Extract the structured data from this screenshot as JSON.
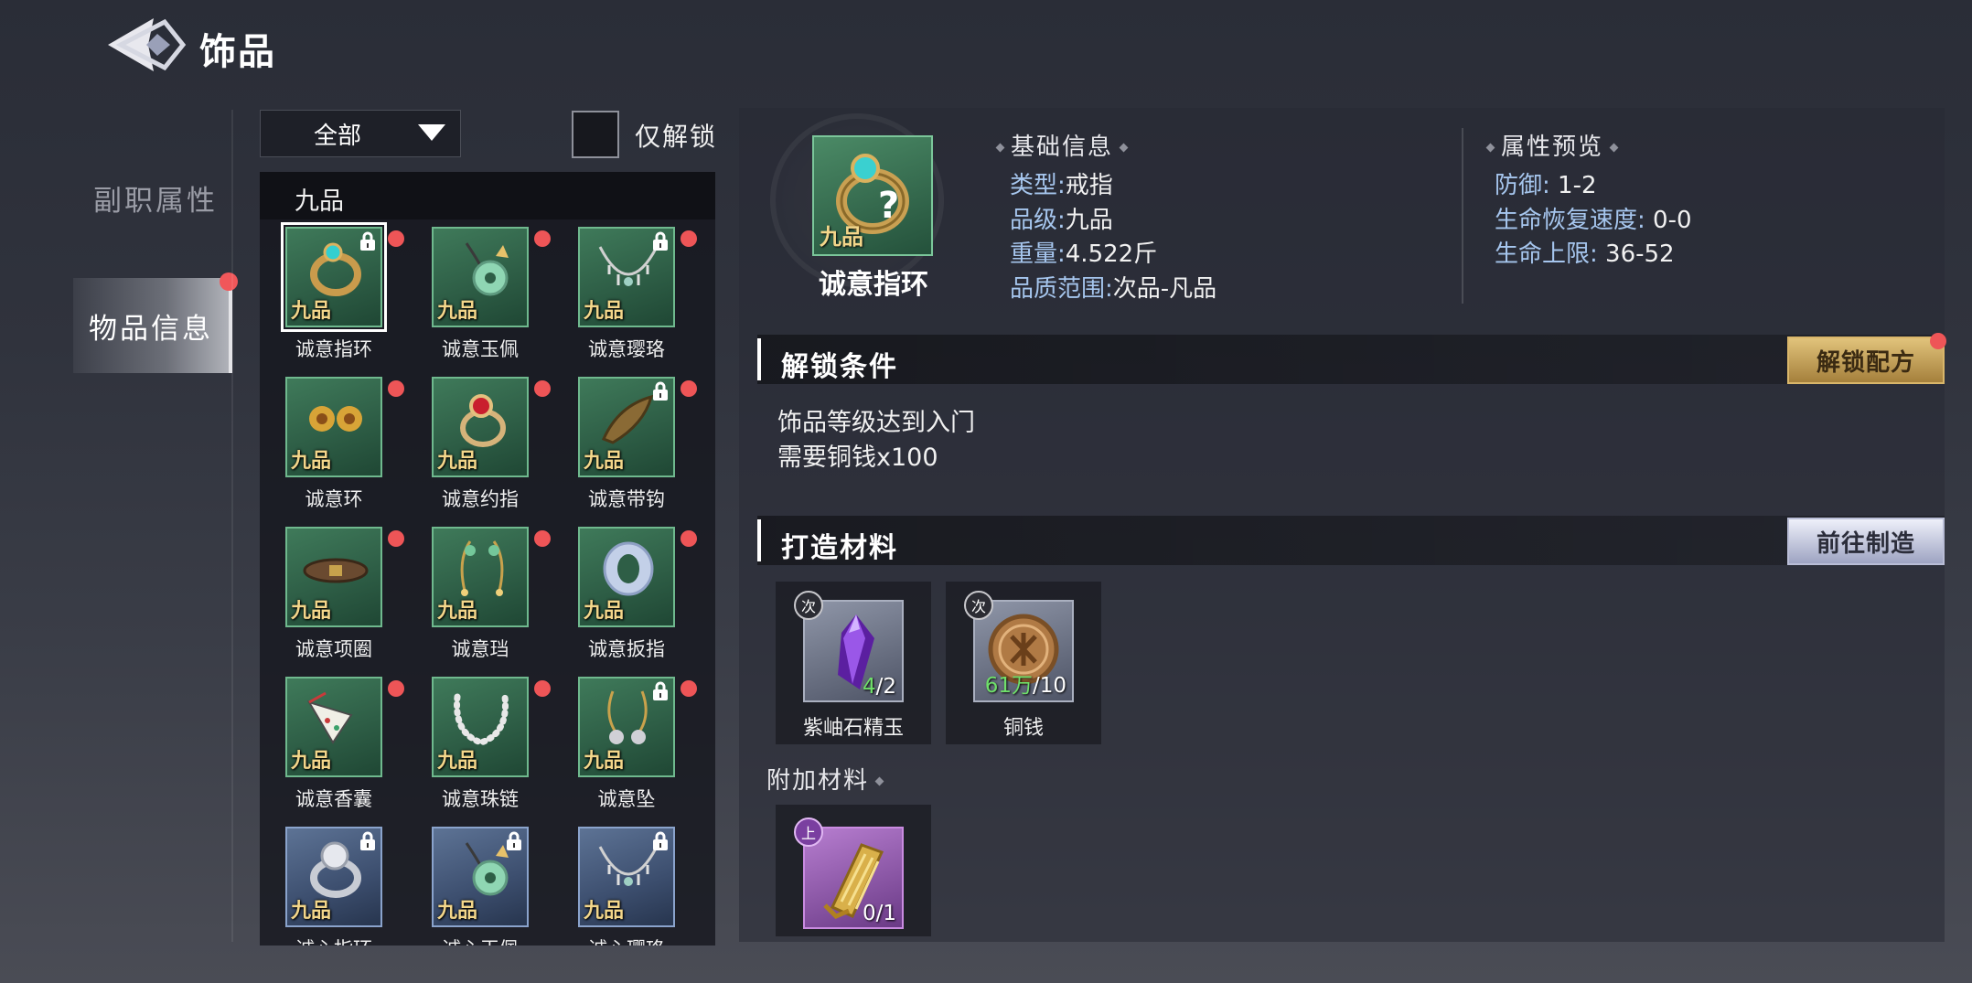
{
  "header": {
    "title": "饰品"
  },
  "sidebar": {
    "tabs": [
      {
        "label": "副职属性",
        "active": false
      },
      {
        "label": "物品信息",
        "active": true
      }
    ]
  },
  "filter": {
    "category_selected": "全部",
    "unlock_only_label": "仅解锁",
    "unlock_only_checked": false
  },
  "list": {
    "group_label": "九品",
    "items": [
      {
        "name": "诚意指环",
        "grade": "九品",
        "rarity": "green",
        "icon": "ring-icon",
        "locked": true,
        "alert": true,
        "selected": true
      },
      {
        "name": "诚意玉佩",
        "grade": "九品",
        "rarity": "green",
        "icon": "jade-pendant-icon",
        "locked": false,
        "alert": true
      },
      {
        "name": "诚意璎珞",
        "grade": "九品",
        "rarity": "green",
        "icon": "necklace-icon",
        "locked": true,
        "alert": true
      },
      {
        "name": "诚意环",
        "grade": "九品",
        "rarity": "green",
        "icon": "earrings-icon",
        "locked": false,
        "alert": true
      },
      {
        "name": "诚意约指",
        "grade": "九品",
        "rarity": "green",
        "icon": "ruby-ring-icon",
        "locked": false,
        "alert": true
      },
      {
        "name": "诚意带钩",
        "grade": "九品",
        "rarity": "green",
        "icon": "belt-hook-icon",
        "locked": true,
        "alert": true
      },
      {
        "name": "诚意项圈",
        "grade": "九品",
        "rarity": "green",
        "icon": "collar-icon",
        "locked": false,
        "alert": true
      },
      {
        "name": "诚意珰",
        "grade": "九品",
        "rarity": "green",
        "icon": "ear-pendant-icon",
        "locked": false,
        "alert": true
      },
      {
        "name": "诚意扳指",
        "grade": "九品",
        "rarity": "green",
        "icon": "thumb-ring-icon",
        "locked": false,
        "alert": true
      },
      {
        "name": "诚意香囊",
        "grade": "九品",
        "rarity": "green",
        "icon": "sachet-icon",
        "locked": false,
        "alert": true
      },
      {
        "name": "诚意珠链",
        "grade": "九品",
        "rarity": "green",
        "icon": "pearl-chain-icon",
        "locked": false,
        "alert": true
      },
      {
        "name": "诚意坠",
        "grade": "九品",
        "rarity": "green",
        "icon": "drop-pendant-icon",
        "locked": true,
        "alert": true
      },
      {
        "name": "诚心指环",
        "grade": "九品",
        "rarity": "blue",
        "icon": "silver-ring-icon",
        "locked": true,
        "alert": false
      },
      {
        "name": "诚心玉佩",
        "grade": "九品",
        "rarity": "blue",
        "icon": "jade-pendant-icon",
        "locked": true,
        "alert": false
      },
      {
        "name": "诚心璎珞",
        "grade": "九品",
        "rarity": "blue",
        "icon": "necklace-icon",
        "locked": true,
        "alert": false
      }
    ]
  },
  "detail": {
    "name": "诚意指环",
    "grade": "九品",
    "basic_title": "基础信息",
    "basic": [
      {
        "key": "类型:",
        "value": "戒指"
      },
      {
        "key": "品级:",
        "value": "九品"
      },
      {
        "key": "重量:",
        "value": "4.522斤"
      },
      {
        "key": "品质范围:",
        "value": "次品-凡品"
      }
    ],
    "attr_title": "属性预览",
    "attrs": [
      {
        "key": "防御:",
        "value": "1-2"
      },
      {
        "key": "生命恢复速度:",
        "value": "0-0"
      },
      {
        "key": "生命上限:",
        "value": "36-52"
      }
    ]
  },
  "unlock": {
    "title": "解锁条件",
    "button": "解锁配方",
    "conditions": [
      "饰品等级达到入门",
      "需要铜钱x100"
    ]
  },
  "craft": {
    "title": "打造材料",
    "button": "前往制造",
    "materials": [
      {
        "name": "紫岫石精玉",
        "badge": "次",
        "have": "4",
        "need": "/2",
        "icon": "purple-crystal-icon"
      },
      {
        "name": "铜钱",
        "badge": "次",
        "have": "61万",
        "need": "/10",
        "icon": "copper-coin-icon"
      }
    ],
    "extra_title": "附加材料",
    "extra": [
      {
        "badge": "上",
        "have": "0",
        "need": "/1",
        "icon": "golden-scroll-icon"
      }
    ]
  },
  "colors": {
    "grade_text": "#f3d68a",
    "alert_dot": "#ee5557",
    "green_card": "#3f7a5a",
    "blue_card": "#5d7395",
    "have_count": "#6fe06a",
    "key_text": "#a6c6ee"
  }
}
